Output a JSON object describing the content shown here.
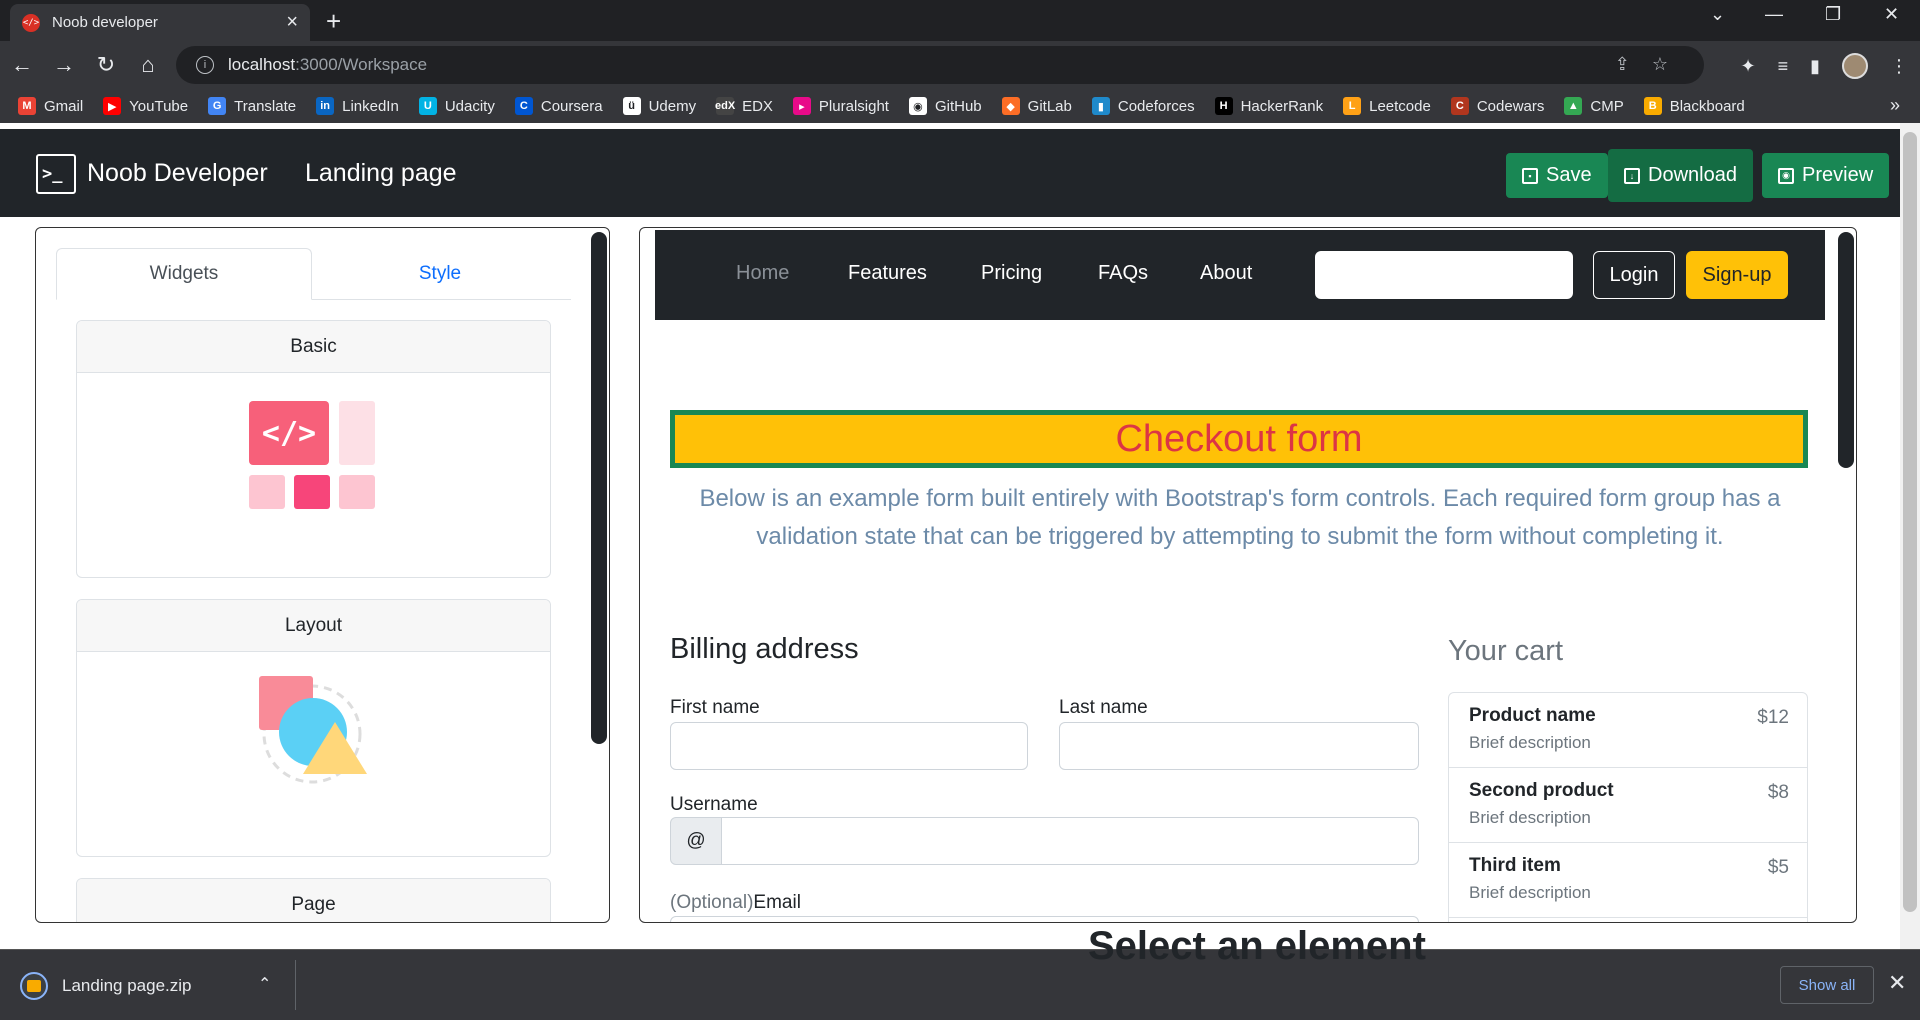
{
  "browser": {
    "tab_title": "Noob developer",
    "tab_favicon_text": "</>",
    "tab_close": "×",
    "new_tab": "+",
    "url_host": "localhost",
    "url_path": ":3000/Workspace",
    "bookmarks": [
      {
        "label": "Gmail",
        "color": "#ea4335",
        "glyph": "M"
      },
      {
        "label": "YouTube",
        "color": "#ff0000",
        "glyph": "▶"
      },
      {
        "label": "Translate",
        "color": "#4285f4",
        "glyph": "G"
      },
      {
        "label": "LinkedIn",
        "color": "#0a66c2",
        "glyph": "in"
      },
      {
        "label": "Udacity",
        "color": "#02b3e4",
        "glyph": "U"
      },
      {
        "label": "Coursera",
        "color": "#0056d2",
        "glyph": "C"
      },
      {
        "label": "Udemy",
        "color": "#ffffff",
        "glyph": "ü"
      },
      {
        "label": "EDX",
        "color": "#444444",
        "glyph": "edX"
      },
      {
        "label": "Pluralsight",
        "color": "#e80a89",
        "glyph": "▸"
      },
      {
        "label": "GitHub",
        "color": "#ffffff",
        "glyph": "◉"
      },
      {
        "label": "GitLab",
        "color": "#fc6d26",
        "glyph": "◆"
      },
      {
        "label": "Codeforces",
        "color": "#1f8acb",
        "glyph": "▮"
      },
      {
        "label": "HackerRank",
        "color": "#000000",
        "glyph": "H"
      },
      {
        "label": "Leetcode",
        "color": "#ffa116",
        "glyph": "L"
      },
      {
        "label": "Codewars",
        "color": "#b1361e",
        "glyph": "C"
      },
      {
        "label": "CMP",
        "color": "#34a853",
        "glyph": "▲"
      },
      {
        "label": "Blackboard",
        "color": "#f9ab00",
        "glyph": "B"
      }
    ],
    "more": "»"
  },
  "app": {
    "brand": "Noob Developer",
    "brand_icon": ">_",
    "page_name": "Landing page",
    "buttons": {
      "save": "Save",
      "download": "Download",
      "preview": "Preview"
    },
    "accent": "#198754"
  },
  "sidebar": {
    "tabs": {
      "widgets": "Widgets",
      "style": "Style"
    },
    "cards": [
      {
        "title": "Basic",
        "icon": "code-blocks-icon"
      },
      {
        "title": "Layout",
        "icon": "shapes-icon"
      },
      {
        "title": "Page",
        "icon": ""
      }
    ]
  },
  "preview": {
    "nav": {
      "links": [
        "Home",
        "Features",
        "Pricing",
        "FAQs",
        "About"
      ],
      "login": "Login",
      "signup": "Sign-up"
    },
    "title": "Checkout form",
    "lead": "Below is an example form built entirely with Bootstrap's form controls. Each required form group has a validation state that can be triggered by attempting to submit the form without completing it.",
    "billing": {
      "heading": "Billing address",
      "first_name": "First name",
      "last_name": "Last name",
      "username": "Username",
      "at": "@",
      "email_optional": "(Optional)",
      "email": "Email"
    },
    "cart": {
      "heading": "Your cart",
      "items": [
        {
          "name": "Product name",
          "desc": "Brief description",
          "price": "$12"
        },
        {
          "name": "Second product",
          "desc": "Brief description",
          "price": "$8"
        },
        {
          "name": "Third item",
          "desc": "Brief description",
          "price": "$5"
        }
      ]
    },
    "overlay_text": "Select an element"
  },
  "downloads": {
    "file": "Landing page.zip",
    "show_all": "Show all",
    "close": "✕"
  }
}
